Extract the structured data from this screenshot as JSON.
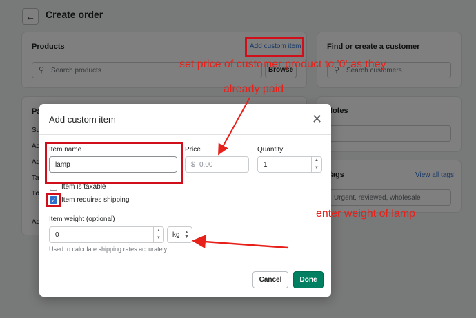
{
  "page": {
    "title": "Create order"
  },
  "products": {
    "title": "Products",
    "add_custom_item": "Add custom item",
    "search_placeholder": "Search products",
    "browse": "Browse"
  },
  "payment": {
    "title_partial": "Pa",
    "row1": "Su",
    "row2": "Ad",
    "row3": "Ad",
    "row4": "Ta",
    "row5": "To",
    "row6": "Ad"
  },
  "customer": {
    "title": "Find or create a customer",
    "search_placeholder": "Search customers"
  },
  "notes": {
    "title": "Notes"
  },
  "tags": {
    "title": "Tags",
    "view_all": "View all tags",
    "placeholder": "Urgent, reviewed, wholesale"
  },
  "modal": {
    "title": "Add custom item",
    "item_name_label": "Item name",
    "item_name_value": "lamp",
    "price_label": "Price",
    "price_prefix": "$",
    "price_placeholder": "0.00",
    "quantity_label": "Quantity",
    "quantity_value": "1",
    "taxable_label": "Item is taxable",
    "taxable_checked": false,
    "shipping_label": "Item requires shipping",
    "shipping_checked": true,
    "weight_label": "Item weight (optional)",
    "weight_value": "0",
    "weight_unit": "kg",
    "weight_help": "Used to calculate shipping rates accurately",
    "cancel": "Cancel",
    "done": "Done"
  },
  "annotations": {
    "price_note_line1": "set price of customer product to '0' as they",
    "price_note_line2": "already paid",
    "weight_note": "enter weight of lamp",
    "color": "#e8201a"
  }
}
